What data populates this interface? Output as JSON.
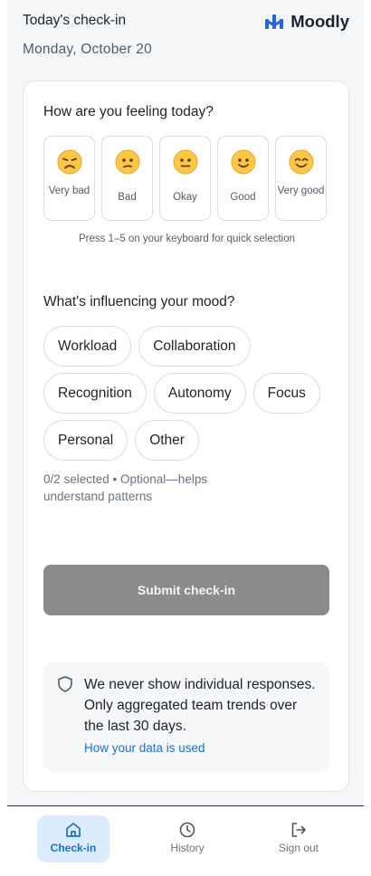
{
  "header": {
    "title": "Today's check-in",
    "date": "Monday, October 20",
    "brand_name": "Moodly",
    "brand_icon": "moodly-logo-icon",
    "accent_color": "#2563eb"
  },
  "mood_section": {
    "question": "How are you feeling today?",
    "options": [
      {
        "label": "Very bad",
        "icon": "very-bad-emoji-icon"
      },
      {
        "label": "Bad",
        "icon": "bad-emoji-icon"
      },
      {
        "label": "Okay",
        "icon": "okay-emoji-icon"
      },
      {
        "label": "Good",
        "icon": "good-emoji-icon"
      },
      {
        "label": "Very good",
        "icon": "very-good-emoji-icon"
      }
    ],
    "hint": "Press 1–5 on your keyboard for quick selection"
  },
  "influence_section": {
    "question": "What's influencing your mood?",
    "chips": [
      "Workload",
      "Collaboration",
      "Recognition",
      "Autonomy",
      "Focus",
      "Personal",
      "Other"
    ],
    "selection_note": "0/2 selected • Optional—helps understand patterns"
  },
  "submit": {
    "label": "Submit check-in",
    "color": "#8b8b8b"
  },
  "privacy": {
    "text": "We never show individual responses. Only aggregated team trends over the last 30 days.",
    "link": "How your data is used",
    "icon": "shield-icon"
  },
  "nav": {
    "items": [
      {
        "label": "Check-in",
        "icon": "home-icon",
        "active": true
      },
      {
        "label": "History",
        "icon": "clock-icon",
        "active": false
      },
      {
        "label": "Sign out",
        "icon": "sign-out-icon",
        "active": false
      }
    ]
  }
}
